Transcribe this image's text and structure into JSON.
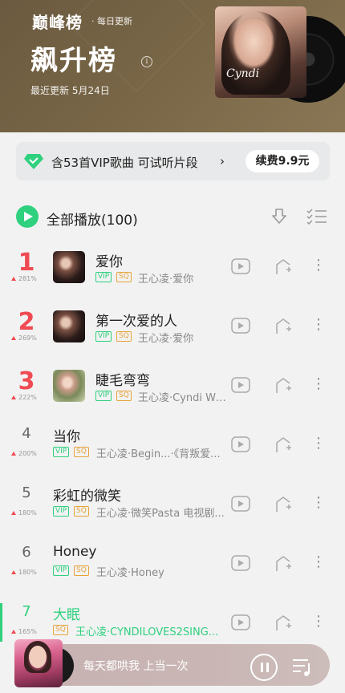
{
  "header": {
    "brand": "巅峰榜",
    "daily_label": "· 每日更新",
    "title": "飙升榜",
    "updated": "最近更新 5月24日",
    "cover_logo": "Cyndi",
    "header_color": "#7a6848"
  },
  "vip_banner": {
    "text": "含53首VIP歌曲 可试听片段",
    "chevron": "›",
    "renew_label": "续费9.9元"
  },
  "list_header": {
    "play_all_label": "全部播放(100)"
  },
  "songs": [
    {
      "rank": "1",
      "trend": "281%",
      "title": "爱你",
      "vip": "VIP",
      "sq": "SQ",
      "meta": "王心凌·爱你"
    },
    {
      "rank": "2",
      "trend": "269%",
      "title": "第一次爱的人",
      "vip": "VIP",
      "sq": "SQ",
      "meta": "王心凌·爱你"
    },
    {
      "rank": "3",
      "trend": "222%",
      "title": "睫毛弯弯",
      "vip": "VIP",
      "sq": "SQ",
      "meta": "王心凌·Cyndi Wit..."
    },
    {
      "rank": "4",
      "trend": "200%",
      "title": "当你",
      "vip": "VIP",
      "sq": "SQ",
      "meta": "王心凌·Begin...·《背叛爱..."
    },
    {
      "rank": "5",
      "trend": "180%",
      "title": "彩虹的微笑",
      "vip": "VIP",
      "sq": "SQ",
      "meta": "王心凌·微笑Pasta 电视剧..."
    },
    {
      "rank": "6",
      "trend": "180%",
      "title": "Honey",
      "vip": "VIP",
      "sq": "SQ",
      "meta": "王心凌·Honey"
    },
    {
      "rank": "7",
      "trend": "165%",
      "title": "大眠",
      "sq": "SQ",
      "meta": "王心凌·CYNDILOVES2SING..."
    }
  ],
  "player": {
    "now_playing": "每天都哄我 上当一次"
  },
  "colors": {
    "accent_green": "#2fd07e",
    "rank_red": "#f04a52",
    "sq_orange": "#e7a33a"
  },
  "icons": {
    "info": "info-icon",
    "diamond": "vip-diamond-icon",
    "download": "download-icon",
    "multi_select": "multi-select-icon",
    "play": "play-icon",
    "add_to_playlist": "add-to-playlist-icon",
    "more": "more-icon",
    "pause": "pause-icon",
    "playlist": "playlist-icon"
  }
}
